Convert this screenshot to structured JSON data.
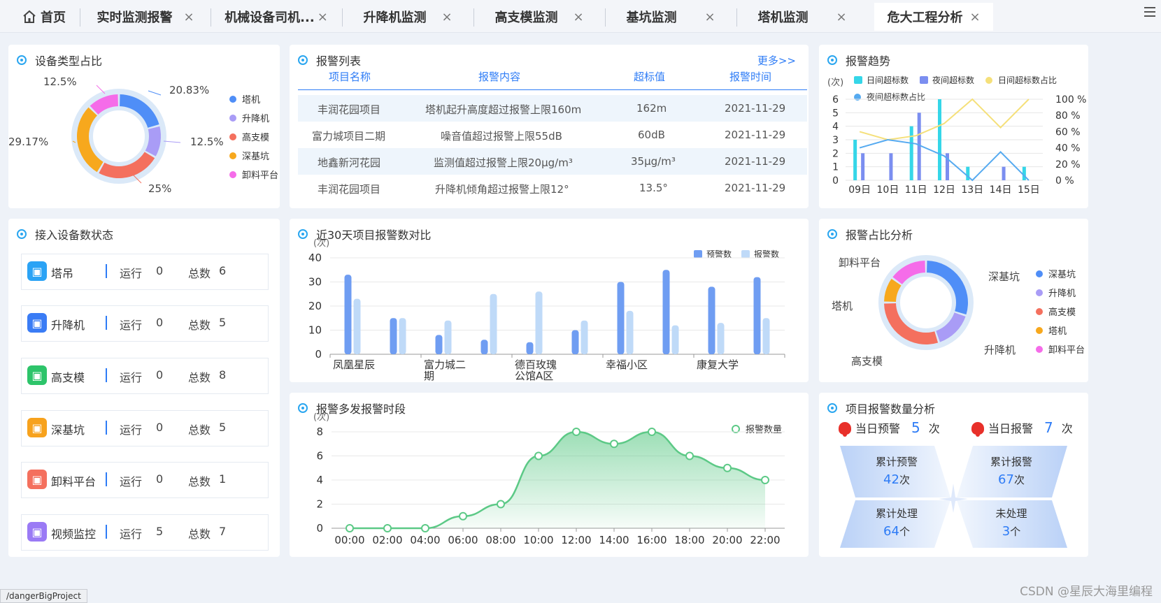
{
  "tabs": [
    {
      "label": "首页",
      "closable": false,
      "active": false
    },
    {
      "label": "实时监测报警",
      "closable": true,
      "active": false
    },
    {
      "label": "机械设备司机...",
      "closable": true,
      "active": false
    },
    {
      "label": "升降机监测",
      "closable": true,
      "active": false
    },
    {
      "label": "高支模监测",
      "closable": true,
      "active": false
    },
    {
      "label": "基坑监测",
      "closable": true,
      "active": false
    },
    {
      "label": "塔机监测",
      "closable": true,
      "active": false
    },
    {
      "label": "危大工程分析",
      "closable": true,
      "active": true
    }
  ],
  "close_glyph": "×",
  "device_type": {
    "title": "设备类型占比",
    "legend": [
      "塔机",
      "升降机",
      "高支模",
      "深基坑",
      "卸料平台"
    ],
    "slice_labels": [
      "20.83%",
      "12.5%",
      "25%",
      "29.17%",
      "12.5%"
    ],
    "colors": [
      "#4f8ef7",
      "#a99cf6",
      "#f4705e",
      "#f7a81d",
      "#f56ce9"
    ]
  },
  "alarm_list": {
    "title": "报警列表",
    "more": "更多>>",
    "headers": [
      "项目名称",
      "报警内容",
      "超标值",
      "报警时间"
    ],
    "rows": [
      [
        "丰润花园项目",
        "塔机起升高度超过报警上限160m",
        "162m",
        "2021-11-29"
      ],
      [
        "富力城项目二期",
        "噪音值超过报警上限55dB",
        "60dB",
        "2021-11-29"
      ],
      [
        "地鑫新河花园",
        "监测值超过报警上限20μg/m³",
        "35μg/m³",
        "2021-11-29"
      ],
      [
        "丰润花园项目",
        "升降机倾角超过报警上限12°",
        "13.5°",
        "2021-11-29"
      ]
    ]
  },
  "alarm_trend": {
    "title": "报警趋势",
    "unit": "(次)",
    "legend": [
      "日间超标数",
      "夜间超标数",
      "日间超标数占比",
      "夜间超标数占比"
    ],
    "colors": [
      "#35d6e8",
      "#7b8ef0",
      "#f5e07a",
      "#55aaf0"
    ]
  },
  "device_status": {
    "title": "接入设备数状态",
    "run_label": "运行",
    "total_label": "总数",
    "items": [
      {
        "name": "塔吊",
        "run": "0",
        "total": "6",
        "icon": "tower-crane-icon",
        "color": "#2ba3f5"
      },
      {
        "name": "升降机",
        "run": "0",
        "total": "5",
        "icon": "elevator-icon",
        "color": "#3a7cf5"
      },
      {
        "name": "高支模",
        "run": "0",
        "total": "8",
        "icon": "formwork-icon",
        "color": "#2dc46a"
      },
      {
        "name": "深基坑",
        "run": "0",
        "total": "5",
        "icon": "foundation-pit-icon",
        "color": "#f7a21d"
      },
      {
        "name": "卸料平台",
        "run": "0",
        "total": "1",
        "icon": "platform-icon",
        "color": "#f4705e"
      },
      {
        "name": "视频监控",
        "run": "5",
        "total": "7",
        "icon": "camera-icon",
        "color": "#9a7af5"
      }
    ]
  },
  "compare30": {
    "title": "近30天项目报警数对比",
    "unit": "(次)",
    "legend": [
      "预警数",
      "报警数"
    ],
    "colors": [
      "#6f9df2",
      "#bfdaf8"
    ]
  },
  "alarm_ratio": {
    "title": "报警占比分析",
    "legend": [
      "深基坑",
      "升降机",
      "高支模",
      "塔机",
      "卸料平台"
    ],
    "slice_labels": [
      "深基坑",
      "升降机",
      "高支模",
      "塔机",
      "卸料平台"
    ],
    "colors": [
      "#4f8ef7",
      "#a99cf6",
      "#f4705e",
      "#f7a81d",
      "#f56ce9"
    ]
  },
  "peak_hours": {
    "title": "报警多发报警时段",
    "unit": "(次)",
    "legend": "报警数量",
    "color": "#5cc986"
  },
  "project_stats": {
    "title": "项目报警数量分析",
    "today_warn_label": "当日预警",
    "today_warn": "5",
    "today_alarm_label": "当日报警",
    "today_alarm": "7",
    "unit": "次",
    "cards": [
      {
        "label": "累计预警",
        "value": "42",
        "unit": "次"
      },
      {
        "label": "累计报警",
        "value": "67",
        "unit": "次"
      },
      {
        "label": "累计处理",
        "value": "64",
        "unit": "个"
      },
      {
        "label": "未处理",
        "value": "3",
        "unit": "个"
      }
    ]
  },
  "status_url": "/dangerBigProject",
  "watermark": "CSDN @星辰大海里编程",
  "chart_data": [
    {
      "type": "pie",
      "title": "设备类型占比",
      "labels": [
        "塔机",
        "升降机",
        "高支模",
        "深基坑",
        "卸料平台"
      ],
      "values": [
        20.83,
        12.5,
        25,
        29.17,
        12.5
      ]
    },
    {
      "type": "bar",
      "title": "报警趋势",
      "categories": [
        "09日",
        "10日",
        "11日",
        "12日",
        "13日",
        "14日",
        "15日"
      ],
      "ylim": [
        0,
        6
      ],
      "y2lim": [
        0,
        100
      ],
      "y_ticks": [
        "0",
        "1",
        "2",
        "3",
        "4",
        "5",
        "6"
      ],
      "y2_ticks": [
        "0 %",
        "20 %",
        "40 %",
        "60 %",
        "80 %",
        "100 %"
      ],
      "series": [
        {
          "name": "日间超标数",
          "type": "bar",
          "values": [
            3,
            0,
            4,
            6,
            1,
            0,
            1
          ]
        },
        {
          "name": "夜间超标数",
          "type": "bar",
          "values": [
            2,
            2,
            5,
            2,
            0,
            1,
            0
          ]
        },
        {
          "name": "日间超标数占比",
          "type": "line",
          "axis": "right",
          "values": [
            60,
            50,
            55,
            70,
            100,
            65,
            100
          ]
        },
        {
          "name": "夜间超标数占比",
          "type": "line",
          "axis": "right",
          "values": [
            40,
            50,
            45,
            30,
            0,
            35,
            0
          ]
        }
      ]
    },
    {
      "type": "bar",
      "title": "近30天项目报警数对比",
      "x_labels": [
        "凤凰星辰",
        "富力城二期",
        "德百玫瑰公馆A区",
        "幸福小区",
        "康复大学"
      ],
      "ylim": [
        0,
        40
      ],
      "y_ticks": [
        "0",
        "10",
        "20",
        "30",
        "40"
      ],
      "series": [
        {
          "name": "预警数",
          "values": [
            33,
            15,
            8,
            6,
            5,
            10,
            30,
            35,
            28,
            32
          ]
        },
        {
          "name": "报警数",
          "values": [
            23,
            15,
            14,
            25,
            26,
            14,
            18,
            12,
            13,
            15
          ]
        }
      ]
    },
    {
      "type": "pie",
      "title": "报警占比分析",
      "labels": [
        "深基坑",
        "升降机",
        "高支模",
        "塔机",
        "卸料平台"
      ],
      "values": [
        30,
        15,
        30,
        10,
        15
      ]
    },
    {
      "type": "area",
      "title": "报警多发报警时段",
      "x": [
        "00:00",
        "02:00",
        "04:00",
        "06:00",
        "08:00",
        "10:00",
        "12:00",
        "14:00",
        "16:00",
        "18:00",
        "20:00",
        "22:00"
      ],
      "ylim": [
        0,
        8
      ],
      "y_ticks": [
        "0",
        "2",
        "4",
        "6",
        "8"
      ],
      "series": [
        {
          "name": "报警数量",
          "values": [
            0,
            0,
            0,
            1,
            2,
            6,
            8,
            7,
            8,
            6,
            5,
            4
          ]
        }
      ]
    }
  ]
}
